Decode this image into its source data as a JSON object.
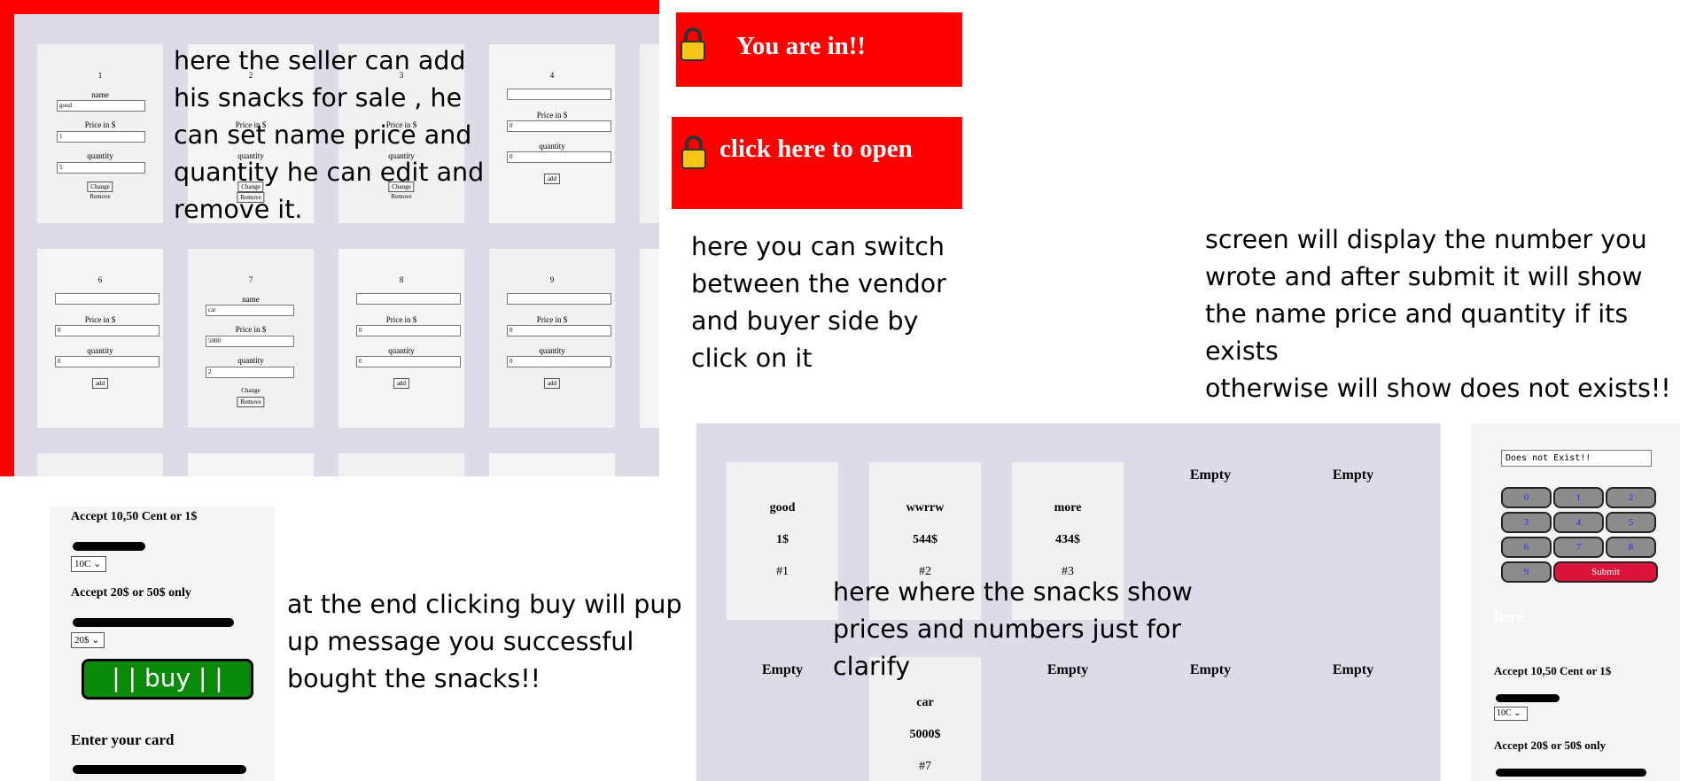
{
  "notes": {
    "seller": [
      "here the seller can add",
      "his snacks for sale , he",
      "can set name price and",
      "quantity he can edit and",
      "remove it."
    ],
    "switch": [
      "here you can switch",
      "between the vendor",
      "and buyer side by",
      "click on it"
    ],
    "screen": [
      "screen will display the number you",
      "wrote and after submit it will show",
      "the name price and quantity if its",
      "exists",
      "otherwise will show does not exists!!"
    ],
    "buy": [
      "at the end clicking buy will pup",
      "up message you successful",
      "bought the snacks!!"
    ],
    "snacks": [
      "here where the snacks show",
      "prices and numbers just for",
      "clarify"
    ]
  },
  "toggles": {
    "in": "You are in!!",
    "open": "click here to open"
  },
  "seller": {
    "row1": [
      {
        "num": "1",
        "name_label": "name",
        "name_value": "good",
        "price_label": "Price in $",
        "price_value": "1",
        "qty_label": "quantity",
        "qty_value": "5",
        "btn1": "Change",
        "btn2": "Remove"
      },
      {
        "num": "2",
        "price_label": "Price in $",
        "qty_label": "quantity",
        "btn1": "Change",
        "btn2": "Remove"
      },
      {
        "num": "3",
        "price_label": "Price in $",
        "qty_label": "quantity",
        "btn1": "Change",
        "btn2": "Remove"
      },
      {
        "num": "4",
        "price_label": "Price in $",
        "price_value": "0",
        "qty_label": "quantity",
        "qty_value": "0",
        "btn1": "add"
      }
    ],
    "row2": [
      {
        "num": "6",
        "price_label": "Price in $",
        "price_value": "0",
        "qty_label": "quantity",
        "qty_value": "0",
        "btn1": "add"
      },
      {
        "num": "7",
        "name_label": "name",
        "name_value": "car",
        "price_label": "Price in $",
        "price_value": "5000",
        "qty_label": "quantity",
        "qty_value": "2",
        "btn1": "Change",
        "btn2": "Remove"
      },
      {
        "num": "8",
        "price_label": "Price in $",
        "price_value": "0",
        "qty_label": "quantity",
        "qty_value": "0",
        "btn1": "add"
      },
      {
        "num": "9",
        "price_label": "Price in $",
        "price_value": "0",
        "qty_label": "quantity",
        "qty_value": "0",
        "btn1": "add"
      }
    ]
  },
  "buyer": {
    "cards": [
      {
        "name": "good",
        "price": "1$",
        "id": "#1"
      },
      {
        "name": "wwrrw",
        "price": "544$",
        "id": "#2"
      },
      {
        "name": "more",
        "price": "434$",
        "id": "#3"
      },
      {
        "name": "car",
        "price": "5000$",
        "id": "#7"
      }
    ],
    "empty": "Empty"
  },
  "keypad": {
    "display": "Does not Exist!!",
    "keys": [
      "0",
      "1",
      "2",
      "3",
      "4",
      "5",
      "6",
      "7",
      "8",
      "9"
    ],
    "submit": "Submit",
    "here": "here",
    "accept1": "Accept 10,50 Cent or 1$",
    "select1": "10C",
    "accept2": "Accept 20$ or 50$ only"
  },
  "payment": {
    "accept1": "Accept 10,50 Cent or 1$",
    "select1": "10C",
    "accept2": "Accept 20$ or 50$ only",
    "select2": "20$",
    "buy": "| | buy | |",
    "card": "Enter your card"
  },
  "colors": {
    "red": "#ff0000",
    "panel": "#dcdbe8",
    "buy_green": "#0a8a0a",
    "submit_red": "#dc143c"
  }
}
